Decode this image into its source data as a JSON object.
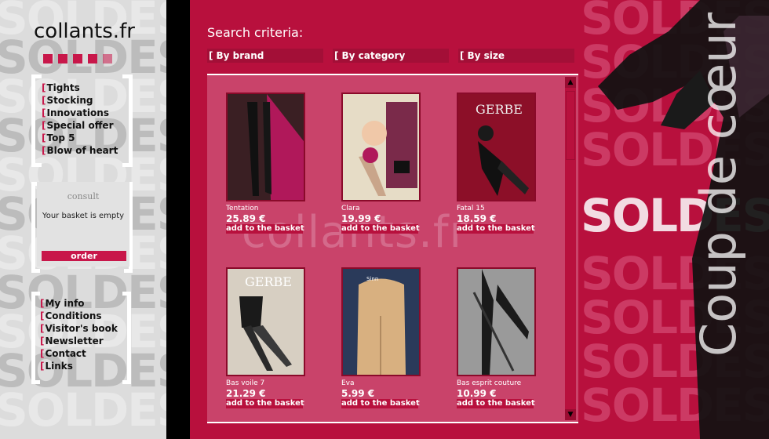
{
  "brand": {
    "logo": "collants.fr"
  },
  "sidebar": {
    "watermark": "SOLDES",
    "menu_top": [
      "Tights",
      "Stocking",
      "Innovations",
      "Special offer",
      "Top 5",
      "Blow of heart"
    ],
    "menu_bottom": [
      "My info",
      "Conditions",
      "Visitor's book",
      "Newsletter",
      "Contact",
      "Links"
    ],
    "basket": {
      "consult": "consult",
      "status": "Your basket is empty",
      "order": "order"
    }
  },
  "search": {
    "title": "Search criteria:",
    "criteria": [
      "By brand",
      "By category",
      "By size"
    ]
  },
  "panel": {
    "watermark": "collants.fr"
  },
  "products": [
    {
      "name": "Tentation",
      "price": "25.89 €",
      "add": "add to the basket",
      "img_bg": "#3a1f23",
      "img_accent": "#b0185a"
    },
    {
      "name": "Clara",
      "price": "19.99 €",
      "add": "add to the basket",
      "img_bg": "#d9c9b0",
      "img_accent": "#7a2a4a"
    },
    {
      "name": "Fatal 15",
      "price": "18.59 €",
      "add": "add to the basket",
      "img_bg": "#8c0f28",
      "img_accent": "#1a1a1a"
    },
    {
      "name": "Bas voile 7",
      "price": "21.29 €",
      "add": "add to the basket",
      "img_bg": "#c9c2b5",
      "img_accent": "#2a2a2a"
    },
    {
      "name": "Eva",
      "price": "5.99 €",
      "add": "add to the basket",
      "img_bg": "#2a3a5a",
      "img_accent": "#d8b080"
    },
    {
      "name": "Bas esprit couture",
      "price": "10.99 €",
      "add": "add to the basket",
      "img_bg": "#9a9a9a",
      "img_accent": "#1a1a1a"
    }
  ],
  "right": {
    "watermark": "SOLDES",
    "vertical": "Coup de cœur"
  },
  "colors": {
    "accent": "#c8174a",
    "center_bg": "#b8103d",
    "panel_bg": "#c9436a"
  }
}
